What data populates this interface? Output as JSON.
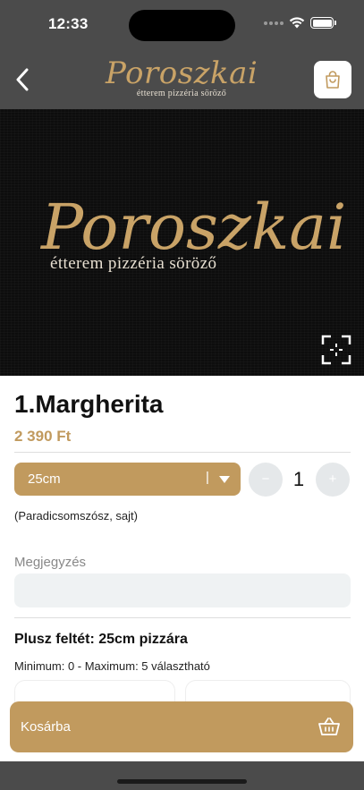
{
  "status_bar": {
    "time": "12:33",
    "icons": [
      "signal-icon",
      "wifi-icon",
      "battery-icon"
    ]
  },
  "header": {
    "logo_title": "Poroszkai",
    "logo_subtitle": "étterem pizzéria söröző",
    "back_icon": "chevron-left-icon",
    "cart_icon": "shopping-bag-icon"
  },
  "hero": {
    "logo_title": "Poroszkai",
    "logo_subtitle": "étterem pizzéria söröző",
    "fullscreen_icon": "fullscreen-icon"
  },
  "product": {
    "title": "1.Margherita",
    "price": "2 390 Ft",
    "size_selected": "25cm",
    "quantity": "1",
    "minus_label": "−",
    "plus_label": "+",
    "ingredients": "(Paradicsomszósz, sajt)"
  },
  "note": {
    "label": "Megjegyzés",
    "value": ""
  },
  "extras": {
    "title": "Plusz feltét: 25cm pizzára",
    "range": "Minimum: 0 - Maximum: 5 választható"
  },
  "cart_button": {
    "label": "Kosárba",
    "icon": "basket-icon"
  },
  "colors": {
    "accent": "#c19a5e",
    "header_bg": "#4b4b4b",
    "hero_bg": "#0d0d0d",
    "logo_gold": "#c9a367",
    "input_bg": "#eff2f3"
  }
}
